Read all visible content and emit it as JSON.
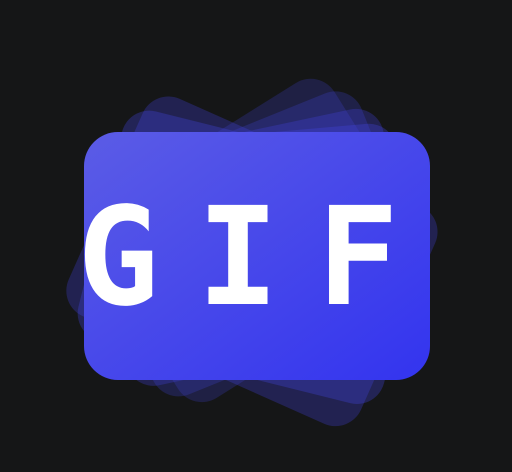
{
  "icon": {
    "name": "gif-maker-app-icon",
    "wordmark": "GIF",
    "colors": {
      "background": "#151617",
      "card_top": "#5b5ce6",
      "card_bottom": "#3334ef",
      "stack_layer": "#4446e8",
      "text": "#ffffff"
    }
  }
}
